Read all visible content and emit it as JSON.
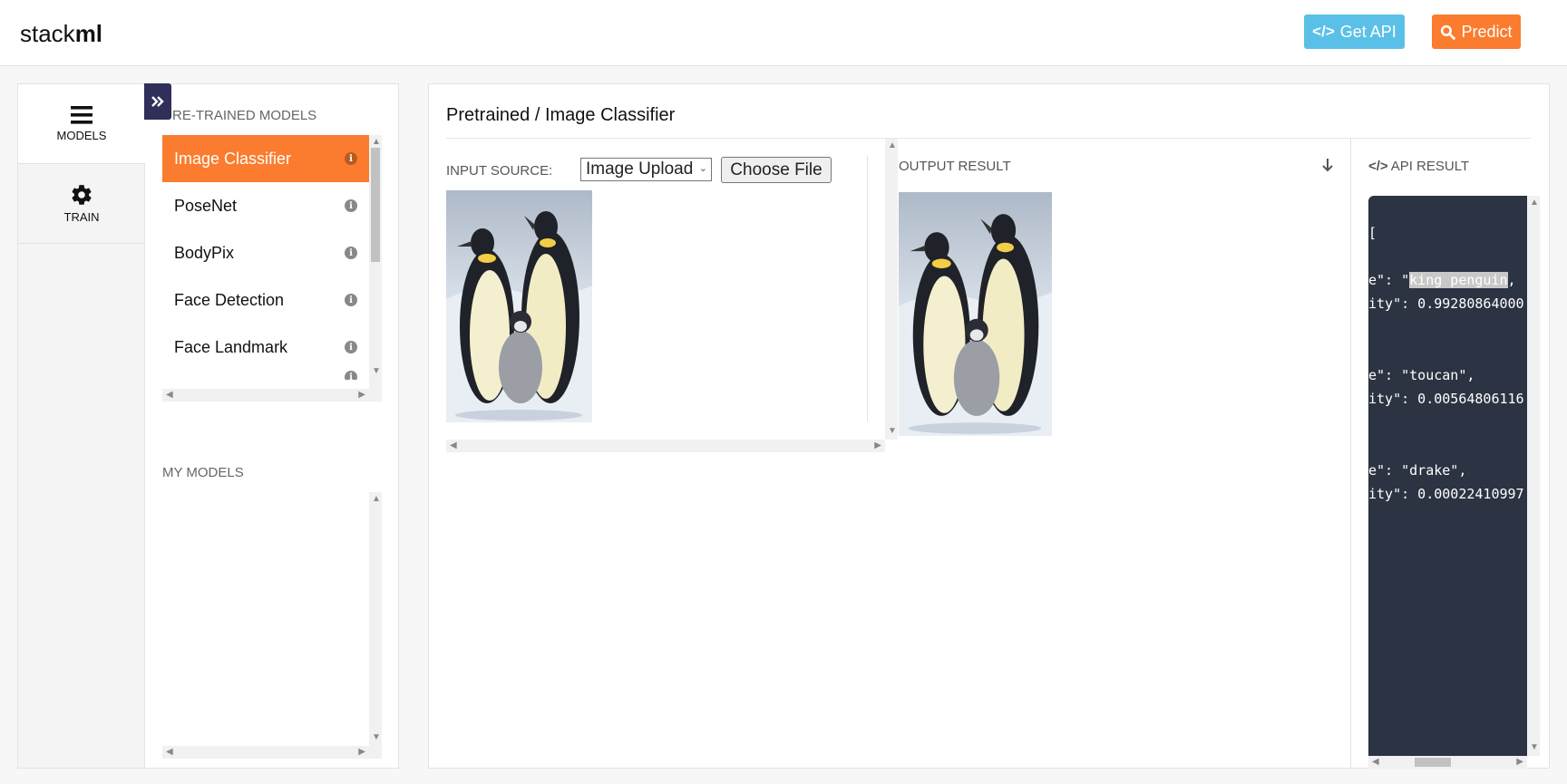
{
  "header": {
    "logo_light": "stack",
    "logo_bold": "ml",
    "get_api_label": "Get API",
    "predict_label": "Predict"
  },
  "nav": {
    "models_label": "MODELS",
    "train_label": "TRAIN"
  },
  "models_panel": {
    "pretrained_title": "RE-TRAINED MODELS",
    "my_models_title": "MY MODELS",
    "items": [
      {
        "label": "Image Classifier",
        "active": true
      },
      {
        "label": "PoseNet"
      },
      {
        "label": "BodyPix"
      },
      {
        "label": "Face Detection"
      },
      {
        "label": "Face Landmark"
      }
    ]
  },
  "main": {
    "breadcrumb": "Pretrained / Image Classifier",
    "input_source_label": "INPUT SOURCE:",
    "input_source_value": "Image Upload",
    "choose_file_label": "Choose File",
    "output_result_label": "OUTPUT RESULT",
    "api_result_label": "API RESULT"
  },
  "api_result": {
    "lines": [
      {
        "text": "["
      },
      {
        "prefix": "e\": \"",
        "highlight": "king penguin",
        "suffix": ","
      },
      {
        "text": "ity\": 0.99280864000"
      },
      {
        "text": "e\": \"toucan\","
      },
      {
        "text": "ity\": 0.00564806116"
      },
      {
        "text": "e\": \"drake\","
      },
      {
        "text": "ity\": 0.00022410997"
      }
    ]
  },
  "colors": {
    "accent_orange": "#fb7c2e",
    "accent_blue": "#5bc0e8",
    "nav_dark": "#2f2f5a",
    "code_bg": "#2c3443"
  },
  "icons": {
    "api": "code-icon",
    "predict": "search-icon",
    "models": "hamburger-icon",
    "train": "gear-icon",
    "collapse": "double-chevron-right-icon",
    "info": "info-icon",
    "output_download": "arrow-down-icon"
  }
}
